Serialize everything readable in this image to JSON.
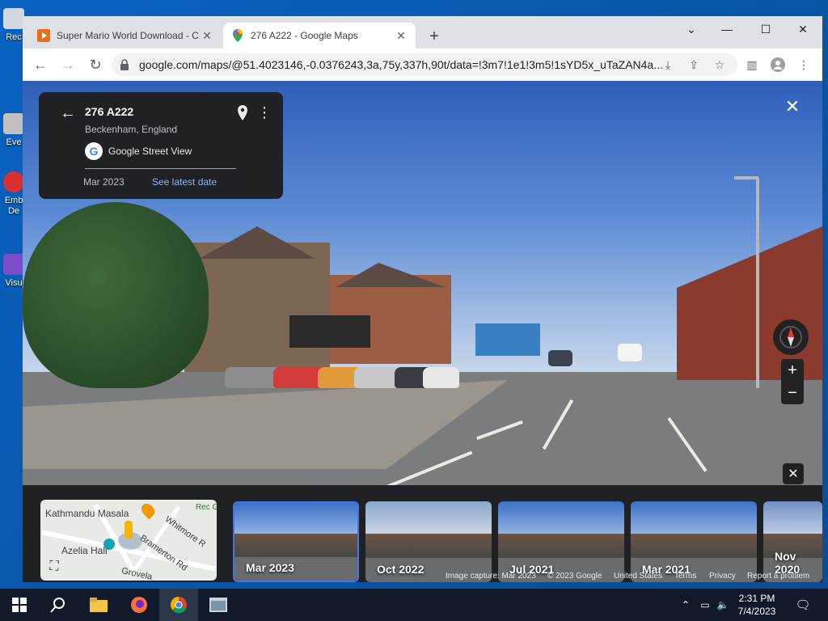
{
  "desktop": {
    "icons": [
      {
        "label": "Rec",
        "color": "#d0d8e0"
      },
      {
        "label": "Eve",
        "color": "#c0c0c0"
      },
      {
        "label": "Emb De",
        "color": "#d93030"
      },
      {
        "label": "Visu",
        "color": "#7a4ccc"
      }
    ]
  },
  "browser": {
    "tabs": [
      {
        "title": "Super Mario World Download - C",
        "favicon": "play-icon",
        "favicon_color": "#e8711a"
      },
      {
        "title": "276 A222 - Google Maps",
        "favicon": "maps-pin-icon"
      }
    ],
    "new_tab": "+",
    "url": "google.com/maps/@51.4023146,-0.0376243,3a,75y,337h,90t/data=!3m7!1e1!3m5!1sYD5x_uTaZAN4a..."
  },
  "streetview": {
    "place": "276 A222",
    "locality": "Beckenham, England",
    "service": "Google Street View",
    "capture_date": "Mar 2023",
    "latest_link": "See latest date"
  },
  "minimap": {
    "labels": [
      "Kathmandu Masala",
      "Azelia Hall",
      "Whitmore R",
      "Bramerton Rd",
      "Grovela",
      "Rec Gro"
    ]
  },
  "timeline": [
    {
      "label": "Mar 2023",
      "selected": true
    },
    {
      "label": "Oct 2022",
      "selected": false
    },
    {
      "label": "Jul 2021",
      "selected": false
    },
    {
      "label": "Mar 2021",
      "selected": false
    },
    {
      "label": "Nov 2020",
      "selected": false
    }
  ],
  "footer": {
    "capture": "Image capture: Mar 2023",
    "copyright": "© 2023 Google",
    "region": "United States",
    "terms": "Terms",
    "privacy": "Privacy",
    "report": "Report a problem"
  },
  "taskbar": {
    "time": "2:31 PM",
    "date": "7/4/2023"
  },
  "colors": {
    "accent": "#8ab4f8",
    "selected_border": "#4a72e0",
    "panel": "#202124"
  }
}
